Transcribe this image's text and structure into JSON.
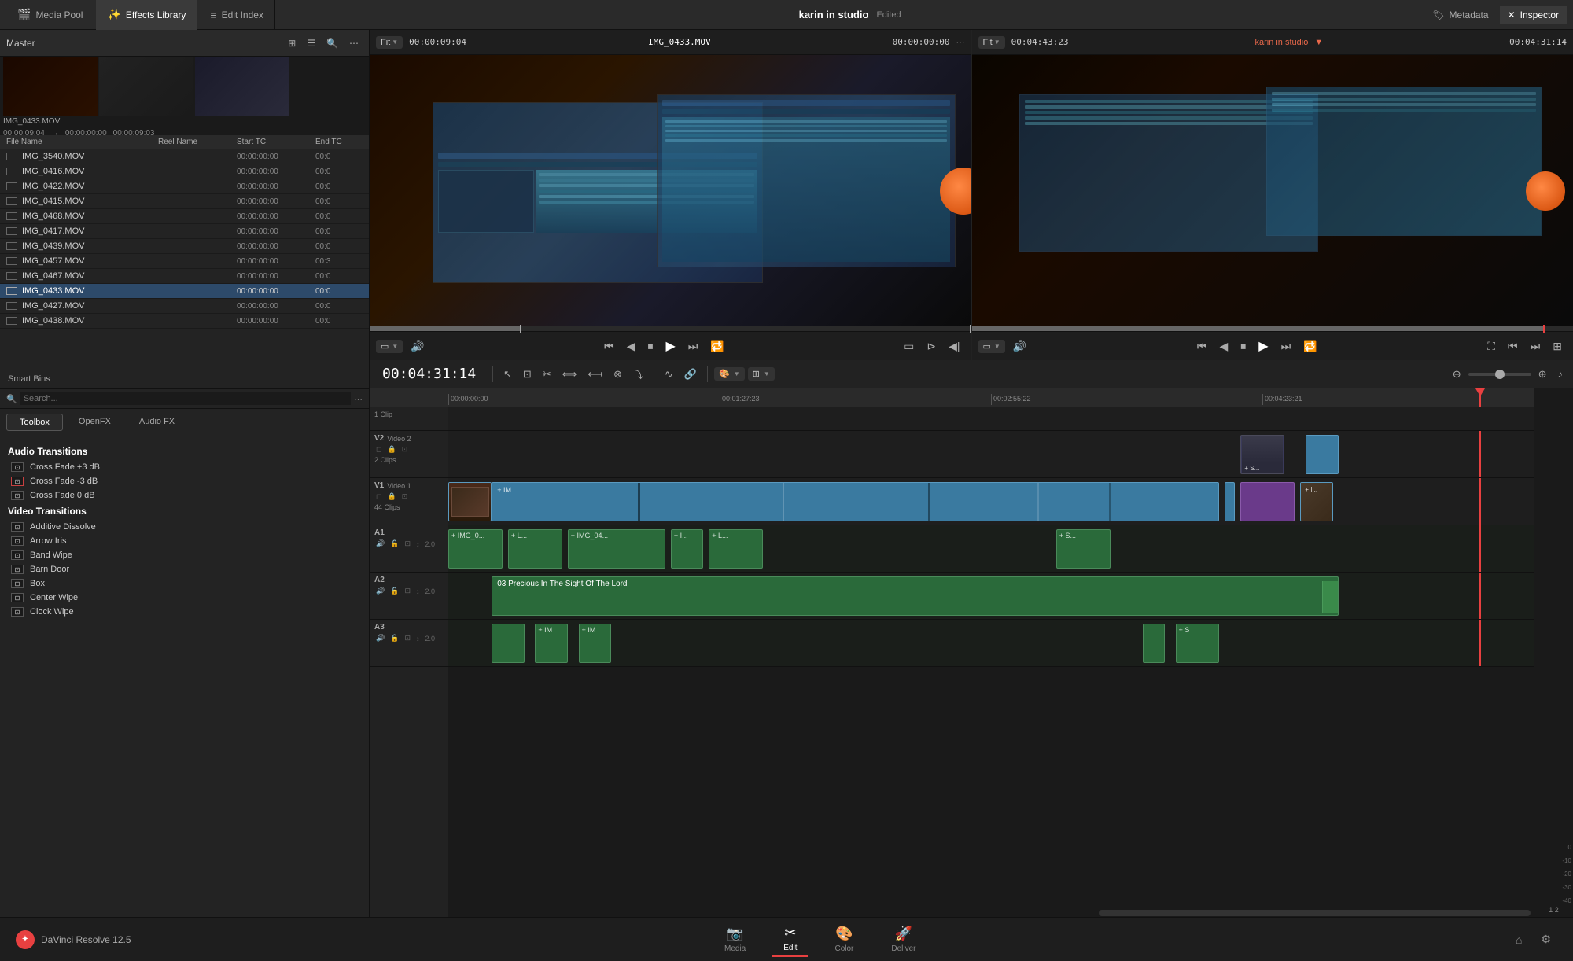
{
  "topbar": {
    "tabs": [
      {
        "id": "media-pool",
        "label": "Media Pool",
        "icon": "🎬",
        "active": false
      },
      {
        "id": "effects-library",
        "label": "Effects Library",
        "icon": "✨",
        "active": true
      },
      {
        "id": "edit-index",
        "label": "Edit Index",
        "icon": "≡",
        "active": false
      }
    ],
    "project_name": "karin in studio",
    "edited_status": "Edited",
    "metadata_label": "Metadata",
    "inspector_label": "Inspector"
  },
  "media_pool": {
    "master_label": "Master",
    "toolbar_icons": [
      "⊞",
      "☰",
      "🔍",
      "⋯"
    ],
    "fit_left": "Fit",
    "timecode_left": "00:00:09:04",
    "filename": "IMG_0433.MOV",
    "timecode_center": "00:00:00:00",
    "timecode_duration": "00:00:09:03",
    "thumb_label": "IMG_0433.MOV",
    "columns": [
      "File Name",
      "Reel Name",
      "Start TC",
      "End TC"
    ],
    "files": [
      {
        "name": "IMG_3540.MOV",
        "reel": "",
        "start": "00:00:00:00",
        "end": "00:0",
        "selected": false
      },
      {
        "name": "IMG_0416.MOV",
        "reel": "",
        "start": "00:00:00:00",
        "end": "00:0",
        "selected": false
      },
      {
        "name": "IMG_0422.MOV",
        "reel": "",
        "start": "00:00:00:00",
        "end": "00:0",
        "selected": false
      },
      {
        "name": "IMG_0415.MOV",
        "reel": "",
        "start": "00:00:00:00",
        "end": "00:0",
        "selected": false
      },
      {
        "name": "IMG_0468.MOV",
        "reel": "",
        "start": "00:00:00:00",
        "end": "00:0",
        "selected": false
      },
      {
        "name": "IMG_0417.MOV",
        "reel": "",
        "start": "00:00:00:00",
        "end": "00:0",
        "selected": false
      },
      {
        "name": "IMG_0439.MOV",
        "reel": "",
        "start": "00:00:00:00",
        "end": "00:0",
        "selected": false
      },
      {
        "name": "IMG_0457.MOV",
        "reel": "",
        "start": "00:00:00:00",
        "end": "00:3",
        "selected": false
      },
      {
        "name": "IMG_0467.MOV",
        "reel": "",
        "start": "00:00:00:00",
        "end": "00:0",
        "selected": false
      },
      {
        "name": "IMG_0433.MOV",
        "reel": "",
        "start": "00:00:00:00",
        "end": "00:0",
        "selected": true
      },
      {
        "name": "IMG_0427.MOV",
        "reel": "",
        "start": "00:00:00:00",
        "end": "00:0",
        "selected": false
      },
      {
        "name": "IMG_0438.MOV",
        "reel": "",
        "start": "00:00:00:00",
        "end": "00:0",
        "selected": false
      }
    ],
    "smart_bins_label": "Smart Bins"
  },
  "effects": {
    "tabs": [
      {
        "label": "Toolbox",
        "active": true
      },
      {
        "label": "OpenFX",
        "active": false
      },
      {
        "label": "Audio FX",
        "active": false
      }
    ],
    "audio_transitions_header": "Audio Transitions",
    "audio_items": [
      {
        "label": "Cross Fade +3 dB",
        "has_indicator": false
      },
      {
        "label": "Cross Fade -3 dB",
        "has_indicator": true
      },
      {
        "label": "Cross Fade 0 dB",
        "has_indicator": false
      }
    ],
    "video_transitions_header": "Video Transitions",
    "video_items": [
      {
        "label": "Additive Dissolve"
      },
      {
        "label": "Arrow Iris"
      },
      {
        "label": "Band Wipe"
      },
      {
        "label": "Barn Door"
      },
      {
        "label": "Box"
      },
      {
        "label": "Center Wipe"
      },
      {
        "label": "Clock Wipe"
      }
    ]
  },
  "preview_left": {
    "fit_label": "Fit",
    "timecode": "00:00:09:04",
    "play_to": "00:00:00:00",
    "duration": "00:00:09:03"
  },
  "preview_right": {
    "fit_label": "Fit",
    "timecode": "00:04:43:23",
    "timeline_name": "karin in studio",
    "end_timecode": "00:04:31:14"
  },
  "timeline": {
    "current_timecode": "00:04:31:14",
    "ruler_marks": [
      "00:00:00:00",
      "00:01:27:23",
      "00:02:55:22",
      "00:04:23:21"
    ],
    "tracks": [
      {
        "id": "clip-1",
        "label": "1 Clip",
        "clips": []
      },
      {
        "id": "v2",
        "label": "Video 2",
        "sub": "2 Clips",
        "clips": [
          {
            "color": "blue",
            "left": "73%",
            "width": "5%",
            "label": "+ S..."
          },
          {
            "color": "blue",
            "left": "79%",
            "width": "4%",
            "label": ""
          }
        ]
      },
      {
        "id": "v1",
        "label": "Video 1",
        "sub": "44 Clips",
        "clips": [
          {
            "color": "blue",
            "left": "0%",
            "width": "70%",
            "label": "+ IM..."
          },
          {
            "color": "blue",
            "left": "71%",
            "width": "2%",
            "label": ""
          },
          {
            "color": "blue",
            "left": "73.5%",
            "width": "1.5%",
            "label": ""
          },
          {
            "color": "purple",
            "left": "75%",
            "width": "5%",
            "label": ""
          },
          {
            "color": "blue",
            "left": "80.5%",
            "width": "1%",
            "label": "+ I..."
          }
        ]
      },
      {
        "id": "a1",
        "label": "A1",
        "sub": "",
        "level": "2.0",
        "clips": [
          {
            "color": "green",
            "left": "0%",
            "width": "5%",
            "label": "+ IMG_0..."
          },
          {
            "color": "green",
            "left": "6%",
            "width": "6%",
            "label": "+ L..."
          },
          {
            "color": "green",
            "left": "13%",
            "width": "10%",
            "label": "+ IMG_04..."
          },
          {
            "color": "green",
            "left": "24%",
            "width": "4%",
            "label": "+ I..."
          },
          {
            "color": "green",
            "left": "29%",
            "width": "6%",
            "label": "+ L..."
          },
          {
            "color": "green",
            "left": "56%",
            "width": "6%",
            "label": "+ S..."
          }
        ]
      },
      {
        "id": "a2",
        "label": "A2",
        "sub": "",
        "level": "2.0",
        "clips": [
          {
            "color": "green",
            "left": "5%",
            "width": "79%",
            "label": "03 Precious In The Sight Of The Lord"
          }
        ]
      },
      {
        "id": "a3",
        "label": "A3",
        "sub": "",
        "level": "2.0",
        "clips": [
          {
            "color": "green",
            "left": "5%",
            "width": "4%",
            "label": ""
          },
          {
            "color": "green",
            "left": "10%",
            "width": "3%",
            "label": "+ IM"
          },
          {
            "color": "green",
            "left": "14%",
            "width": "3%",
            "label": "+ IM"
          },
          {
            "color": "green",
            "left": "65%",
            "width": "2%",
            "label": ""
          },
          {
            "color": "green",
            "left": "68%",
            "width": "4%",
            "label": "+ S"
          }
        ]
      }
    ]
  },
  "bottom_nav": {
    "items": [
      {
        "label": "Media",
        "icon": "📷",
        "active": false
      },
      {
        "label": "Edit",
        "icon": "✂️",
        "active": true
      },
      {
        "label": "Color",
        "icon": "🎨",
        "active": false
      },
      {
        "label": "Deliver",
        "icon": "🚀",
        "active": false
      }
    ],
    "app_name": "DaVinci Resolve 12.5",
    "settings_icon": "⚙",
    "home_icon": "⌂"
  }
}
